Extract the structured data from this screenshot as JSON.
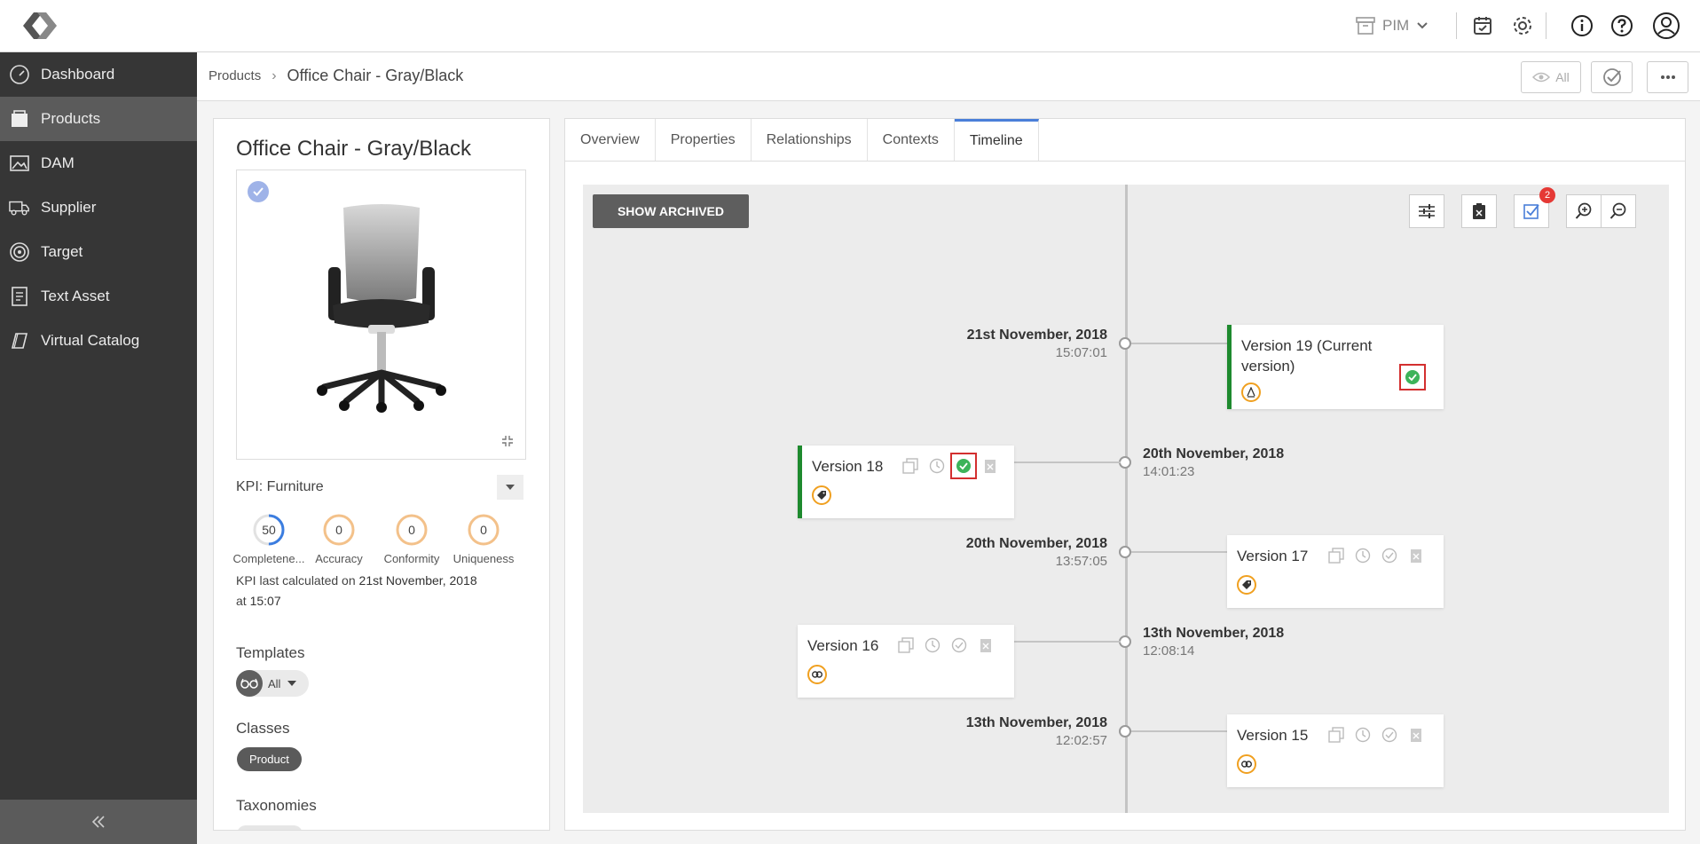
{
  "header": {
    "module": "PIM",
    "icons": [
      "calendar-check-icon",
      "gear-icon",
      "info-icon",
      "help-icon",
      "user-icon"
    ]
  },
  "sidebar": {
    "items": [
      {
        "label": "Dashboard",
        "icon": "speedometer-icon"
      },
      {
        "label": "Products",
        "icon": "box-icon",
        "active": true
      },
      {
        "label": "DAM",
        "icon": "image-icon"
      },
      {
        "label": "Supplier",
        "icon": "truck-icon"
      },
      {
        "label": "Target",
        "icon": "target-icon"
      },
      {
        "label": "Text Asset",
        "icon": "document-icon"
      },
      {
        "label": "Virtual Catalog",
        "icon": "catalog-icon"
      }
    ]
  },
  "breadcrumb": {
    "parent": "Products",
    "separator": "›",
    "current": "Office Chair - Gray/Black"
  },
  "header_actions": {
    "view_all_label": "All"
  },
  "product": {
    "title": "Office Chair - Gray/Black",
    "kpi_label": "KPI:  Furniture",
    "kpis": [
      {
        "value": "50",
        "label": "Completene...",
        "color": "#3b7de0",
        "fill": 0.5
      },
      {
        "value": "0",
        "label": "Accuracy",
        "color": "#f3c18a",
        "fill": 0
      },
      {
        "value": "0",
        "label": "Conformity",
        "color": "#f3c18a",
        "fill": 0
      },
      {
        "value": "0",
        "label": "Uniqueness",
        "color": "#f3c18a",
        "fill": 0
      }
    ],
    "kpi_calc_prefix": "KPI last calculated on ",
    "kpi_calc_date": "21st November, 2018",
    "kpi_calc_mid": " at ",
    "kpi_calc_time": "15:07",
    "templates_heading": "Templates",
    "templates_value": "All",
    "classes_heading": "Classes",
    "class_value": "Product",
    "taxonomies_heading": "Taxonomies"
  },
  "tabs": [
    "Overview",
    "Properties",
    "Relationships",
    "Contexts",
    "Timeline"
  ],
  "active_tab": "Timeline",
  "timeline": {
    "show_archived_label": "SHOW ARCHIVED",
    "approval_badge": "2",
    "entries": [
      {
        "date": "21st November, 2018",
        "time": "15:07:01",
        "version": "Version 19 (Current version)",
        "tag": "attribute-icon",
        "approved": true
      },
      {
        "date": "20th November, 2018",
        "time": "14:01:23",
        "version": "Version 18",
        "tag": "tag-icon",
        "approved": true
      },
      {
        "date": "20th November, 2018",
        "time": "13:57:05",
        "version": "Version 17",
        "tag": "tag-icon",
        "approved": false
      },
      {
        "date": "13th November, 2018",
        "time": "12:08:14",
        "version": "Version 16",
        "tag": "link-icon",
        "approved": false
      },
      {
        "date": "13th November, 2018",
        "time": "12:02:57",
        "version": "Version 15",
        "tag": "link-icon",
        "approved": false
      }
    ]
  }
}
